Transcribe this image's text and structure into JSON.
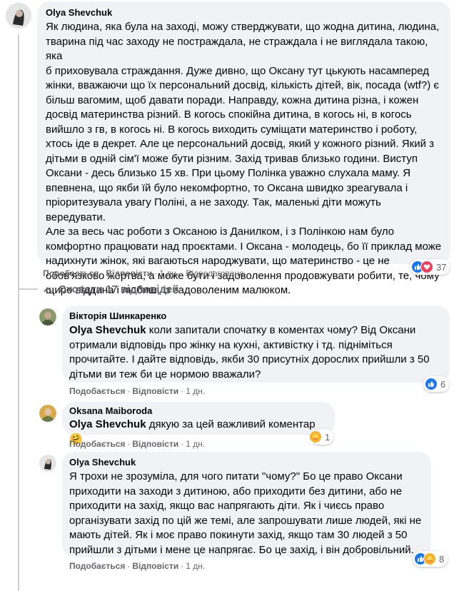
{
  "colors": {
    "bubble": "#f0f2f5",
    "meta": "#65676b",
    "like": "#1877f2",
    "love": "#f33e58",
    "care": "#f7b125"
  },
  "main_comment": {
    "author": "Olya Shevchuk",
    "lines": [
      "Як людина, яка була на заході, можу стверджувати, що жодна дитина, людина,",
      "тварина під час заходу не постраждала, не страждала і не виглядала такою, яка",
      "б приховувала страждання. Дуже дивно, що Оксану тут цькують насамперед",
      "жінки, вважаючи що їх персональний досвід, кількість дітей, вік, посада (wtf?) є",
      "більш вагомим, щоб давати поради. Направду, кожна дитина різна, і кожен",
      "досвід материнства різний. В когось спокійна дитина, в когось ні, в когось",
      "вийшло з гв, в когось ні. В когось виходить суміщати материнство і роботу,",
      "хтось іде в декрет. Але це персональний досвід, який у кожного різний. Який з",
      "дітьми в одній сім'ї може бути різним. Захід тривав близько години. Виступ",
      "Оксани - десь близько 15 хв. При цьому Полінка уважно слухала маму. Я",
      "впевнена, що якби їй було некомфортно, то Оксана швидко зреагувала і",
      "пріоритезувала увагу Поліні, а не заходу. Так, маленькі діти можуть вередувати.",
      "Але за весь час роботи з Оксаною із Данилком, і з Полінкою нам було",
      "комфортно працювати над проєктами. І Оксана - молодець, бо її приклад може",
      "надихнути жінок, які вагаються народжувати, що материнство - це не",
      "обов'язково жертва, а може бути і задоволення продовжувати робити, те, чому",
      "щиро віддана і любиш, із задоволеним малюком."
    ],
    "like": "Подобається",
    "reply": "Відповісти",
    "time": "1 дн.",
    "edited": "Відредаговано",
    "reactions": "37"
  },
  "toggle_label": "Сховати 17 відповідей",
  "replies": [
    {
      "author": "Вікторія Шинкаренко",
      "mention": "Olya Shevchuk",
      "first_line_rest": " коли запитали спочатку в коментах чому? Від Оксани",
      "lines": [
        "отримали відповідь про жінку на кухні, активістку і тд. підніміться",
        "прочитайте. І дайте відповідь, якби 30 присутніх дорослих прийшли з 50",
        "дітьми ви теж би це нормою вважали?"
      ],
      "like": "Подобається",
      "reply": "Відповісти",
      "time": "1 дн.",
      "reactions": "6"
    },
    {
      "author": "Oksana Maiboroda",
      "mention": "Olya Shevchuk",
      "first_line_rest": " дякую за цей важливий коментар 🤗",
      "lines": [],
      "like": "Подобається",
      "reply": "Відповісти",
      "time": "1 дн.",
      "reactions": "1"
    },
    {
      "author": "Olya Shevchuk",
      "mention": "",
      "first_line_rest": "",
      "lines": [
        "Я трохи не зрозуміла, для чого питати \"чому?\" Бо це право Оксани",
        "приходити на заходи з дитиною, або приходити без дитини, або не",
        "приходити на захід, якщо вас напрягають діти. Як і чиєсь право",
        "організувати захід по цій же темі, але запрошувати лише людей, які не",
        "мають дітей. Як і моє право покинути захід, якщо там 30 людей з 50",
        "прийшли з дітьми і мене це напрягає. Бо це захід, і він добровільний."
      ],
      "like": "Подобається",
      "reply": "Відповісти",
      "time": "1 дн.",
      "reactions": "8"
    }
  ]
}
